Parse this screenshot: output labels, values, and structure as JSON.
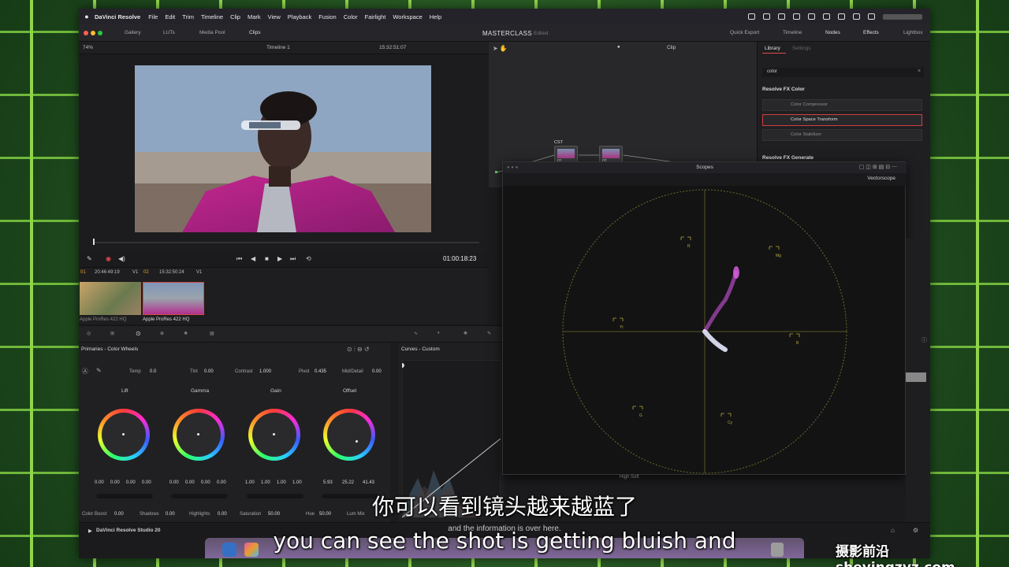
{
  "menubar": {
    "app": "DaVinci Resolve",
    "items": [
      "File",
      "Edit",
      "Trim",
      "Timeline",
      "Clip",
      "Mark",
      "View",
      "Playback",
      "Fusion",
      "Color",
      "Fairlight",
      "Workspace",
      "Help"
    ]
  },
  "toolbar": {
    "gallery": "Gallery",
    "luts": "LUTs",
    "media_pool": "Media Pool",
    "clips": "Clips",
    "project_title": "MASTERCLASS",
    "project_status": "Edited",
    "quick_export": "Quick Export",
    "timeline": "Timeline",
    "nodes": "Nodes",
    "effects": "Effects",
    "lightbox": "Lightbox"
  },
  "viewer": {
    "zoom": "74%",
    "timeline_name": "Timeline 1",
    "source_tc": "15:32:51:07",
    "record_tc": "01:00:18:23"
  },
  "clips": [
    {
      "num": "01",
      "tc": "20:46:49:19",
      "track": "V1",
      "codec": "Apple ProRes 422 HQ"
    },
    {
      "num": "02",
      "tc": "15:32:50:24",
      "track": "V1",
      "codec": "Apple ProRes 422 HQ"
    }
  ],
  "nodes": {
    "mode": "Clip",
    "label": "CST",
    "node1": "01",
    "node2": "02"
  },
  "library": {
    "tab_library": "Library",
    "tab_settings": "Settings",
    "search": "color",
    "section1": "Resolve FX Color",
    "items": [
      "Color Compressor",
      "Color Space Transform",
      "Color Stabilizer"
    ],
    "section2": "Resolve FX Generate"
  },
  "scopes": {
    "title": "Scopes",
    "mode": "Vectorscope",
    "targets": [
      "R",
      "Mg",
      "B",
      "Cy",
      "G",
      "Yl"
    ]
  },
  "primaries": {
    "title": "Primaries - Color Wheels",
    "temp_label": "Temp",
    "temp": "0.0",
    "tint_label": "Tint",
    "tint": "0.00",
    "contrast_label": "Contrast",
    "contrast": "1.000",
    "pivot_label": "Pivot",
    "pivot": "0.435",
    "middetail_label": "Mid/Detail",
    "middetail": "0.00",
    "wheels": [
      {
        "name": "Lift",
        "values": [
          "0.00",
          "0.00",
          "0.00",
          "0.00"
        ]
      },
      {
        "name": "Gamma",
        "values": [
          "0.00",
          "0.00",
          "0.00",
          "0.00"
        ]
      },
      {
        "name": "Gain",
        "values": [
          "1.00",
          "1.00",
          "1.00",
          "1.00"
        ]
      },
      {
        "name": "Offset",
        "values": [
          "5.93",
          "25.22",
          "41.43"
        ]
      }
    ],
    "color_boost_label": "Color Boost",
    "color_boost": "0.00",
    "shadows_label": "Shadows",
    "shadows": "0.00",
    "highlights_label": "Highlights",
    "highlights": "0.00",
    "saturation_label": "Saturation",
    "saturation": "50.00",
    "hue_label": "Hue",
    "hue": "50.00",
    "lum_mix_label": "Lum Mix"
  },
  "curves": {
    "title": "Curves - Custom",
    "high_soft": "High Soft"
  },
  "bottom": {
    "app_name": "DaVinci Resolve Studio 20"
  },
  "subtitles": {
    "cn": "你可以看到镜头越来越蓝了",
    "en": "you can see the shot is getting bluish and",
    "small": "and the information is over here."
  },
  "watermark": "摄影前沿 sheyingzyz.com",
  "colors": {
    "accent_red": "#e04a4a",
    "vectorscope_trace": "#d060e0",
    "grid_green": "#8fd44a"
  }
}
